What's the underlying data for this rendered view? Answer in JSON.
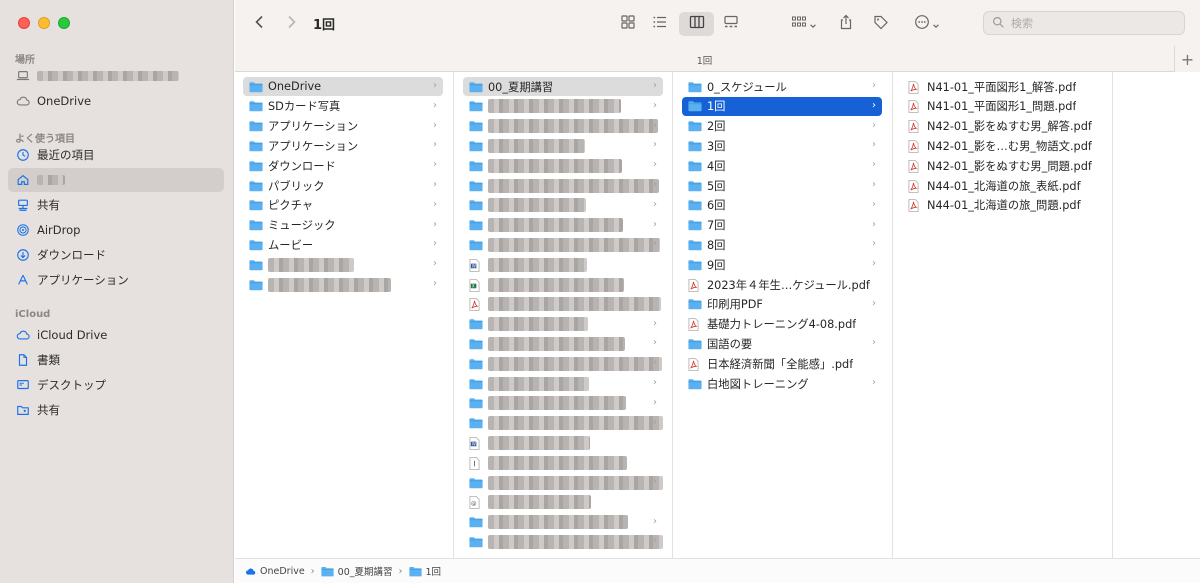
{
  "window": {
    "title": "1回",
    "subtitle": "1回"
  },
  "toolbar": {
    "back_icon": "chevron-left-icon",
    "forward_icon": "chevron-right-icon",
    "search_placeholder": "検索"
  },
  "sidebar": {
    "section_places": "場所",
    "section_favorites": "よく使う項目",
    "section_icloud": "iCloud",
    "places": [
      {
        "label": "",
        "icon": "laptop-icon",
        "blurred": true
      },
      {
        "label": "OneDrive",
        "icon": "cloud-icon"
      }
    ],
    "favorites": [
      {
        "label": "最近の項目",
        "icon": "clock-icon"
      },
      {
        "label": "",
        "icon": "home-icon",
        "blurred": true,
        "selected": true
      },
      {
        "label": "共有",
        "icon": "shared-icon"
      },
      {
        "label": "AirDrop",
        "icon": "airdrop-icon"
      },
      {
        "label": "ダウンロード",
        "icon": "download-icon"
      },
      {
        "label": "アプリケーション",
        "icon": "applications-icon"
      }
    ],
    "icloud": [
      {
        "label": "iCloud Drive",
        "icon": "icloud-icon"
      },
      {
        "label": "書類",
        "icon": "document-icon"
      },
      {
        "label": "デスクトップ",
        "icon": "desktop-icon"
      },
      {
        "label": "共有",
        "icon": "shared-folder-icon"
      }
    ]
  },
  "columns": {
    "col1": [
      {
        "label": "OneDrive",
        "type": "folder",
        "state": "hl"
      },
      {
        "label": "SDカード写真",
        "type": "folder"
      },
      {
        "label": "アプリケーション",
        "type": "folder"
      },
      {
        "label": "アプリケーション",
        "type": "folder"
      },
      {
        "label": "ダウンロード",
        "type": "folder"
      },
      {
        "label": "パブリック",
        "type": "folder"
      },
      {
        "label": "ピクチャ",
        "type": "folder"
      },
      {
        "label": "ミュージック",
        "type": "folder"
      },
      {
        "label": "ムービー",
        "type": "folder"
      },
      {
        "label": "",
        "type": "folder",
        "blurred": true
      },
      {
        "label": "",
        "type": "folder",
        "blurred": true
      }
    ],
    "col2": [
      {
        "label": "00_夏期講習",
        "type": "folder",
        "state": "hl"
      },
      {
        "label": "",
        "type": "folder",
        "blurred": true
      },
      {
        "label": "",
        "type": "folder",
        "blurred": true
      },
      {
        "label": "",
        "type": "folder",
        "blurred": true
      },
      {
        "label": "",
        "type": "folder",
        "blurred": true
      },
      {
        "label": "",
        "type": "folder",
        "blurred": true
      },
      {
        "label": "",
        "type": "folder",
        "blurred": true
      },
      {
        "label": "",
        "type": "folder",
        "blurred": true
      },
      {
        "label": "",
        "type": "folder",
        "blurred": true
      },
      {
        "label": "",
        "type": "word",
        "blurred": true,
        "nochev": true
      },
      {
        "label": "",
        "type": "excel",
        "blurred": true,
        "nochev": true
      },
      {
        "label": "",
        "type": "pdf",
        "blurred": true,
        "nochev": true
      },
      {
        "label": "",
        "type": "folder",
        "blurred": true
      },
      {
        "label": "",
        "type": "folder",
        "blurred": true
      },
      {
        "label": "",
        "type": "folder",
        "blurred": true
      },
      {
        "label": "",
        "type": "folder",
        "blurred": true
      },
      {
        "label": "",
        "type": "folder",
        "blurred": true
      },
      {
        "label": "",
        "type": "folder",
        "blurred": true
      },
      {
        "label": "",
        "type": "word",
        "blurred": true,
        "nochev": true
      },
      {
        "label": "",
        "type": "text",
        "blurred": true,
        "nochev": true
      },
      {
        "label": "",
        "type": "folder",
        "blurred": true
      },
      {
        "label": "",
        "type": "at",
        "blurred": true,
        "nochev": true
      },
      {
        "label": "",
        "type": "folder",
        "blurred": true
      },
      {
        "label": "",
        "type": "folder",
        "blurred": true
      }
    ],
    "col3": [
      {
        "label": "0_スケジュール",
        "type": "folder"
      },
      {
        "label": "1回",
        "type": "folder",
        "state": "sel"
      },
      {
        "label": "2回",
        "type": "folder"
      },
      {
        "label": "3回",
        "type": "folder"
      },
      {
        "label": "4回",
        "type": "folder"
      },
      {
        "label": "5回",
        "type": "folder"
      },
      {
        "label": "6回",
        "type": "folder"
      },
      {
        "label": "7回",
        "type": "folder"
      },
      {
        "label": "8回",
        "type": "folder"
      },
      {
        "label": "9回",
        "type": "folder"
      },
      {
        "label": "2023年４年生…ケジュール.pdf",
        "type": "pdf",
        "nochev": true
      },
      {
        "label": "印刷用PDF",
        "type": "folder"
      },
      {
        "label": "基礎力トレーニング4-08.pdf",
        "type": "pdf",
        "nochev": true
      },
      {
        "label": "国語の要",
        "type": "folder"
      },
      {
        "label": "日本経済新聞「全能感」.pdf",
        "type": "pdf",
        "nochev": true
      },
      {
        "label": "白地図トレーニング",
        "type": "folder"
      }
    ],
    "col4": [
      {
        "label": "N41-01_平面図形1_解答.pdf",
        "type": "pdf",
        "nochev": true
      },
      {
        "label": "N41-01_平面図形1_問題.pdf",
        "type": "pdf",
        "nochev": true
      },
      {
        "label": "N42-01_影をぬすむ男_解答.pdf",
        "type": "pdf",
        "nochev": true
      },
      {
        "label": "N42-01_影を…む男_物語文.pdf",
        "type": "pdf",
        "nochev": true
      },
      {
        "label": "N42-01_影をぬすむ男_問題.pdf",
        "type": "pdf",
        "nochev": true
      },
      {
        "label": "N44-01_北海道の旅_表紙.pdf",
        "type": "pdf",
        "nochev": true
      },
      {
        "label": "N44-01_北海道の旅_問題.pdf",
        "type": "pdf",
        "nochev": true
      }
    ]
  },
  "pathbar": [
    {
      "label": "OneDrive",
      "icon": "cloud-icon"
    },
    {
      "label": "00_夏期講習",
      "icon": "folder-icon"
    },
    {
      "label": "1回",
      "icon": "folder-icon"
    }
  ],
  "colors": {
    "accent": "#1761d6",
    "folder": "#5ab0f0",
    "pdf": "#d63b2f"
  }
}
